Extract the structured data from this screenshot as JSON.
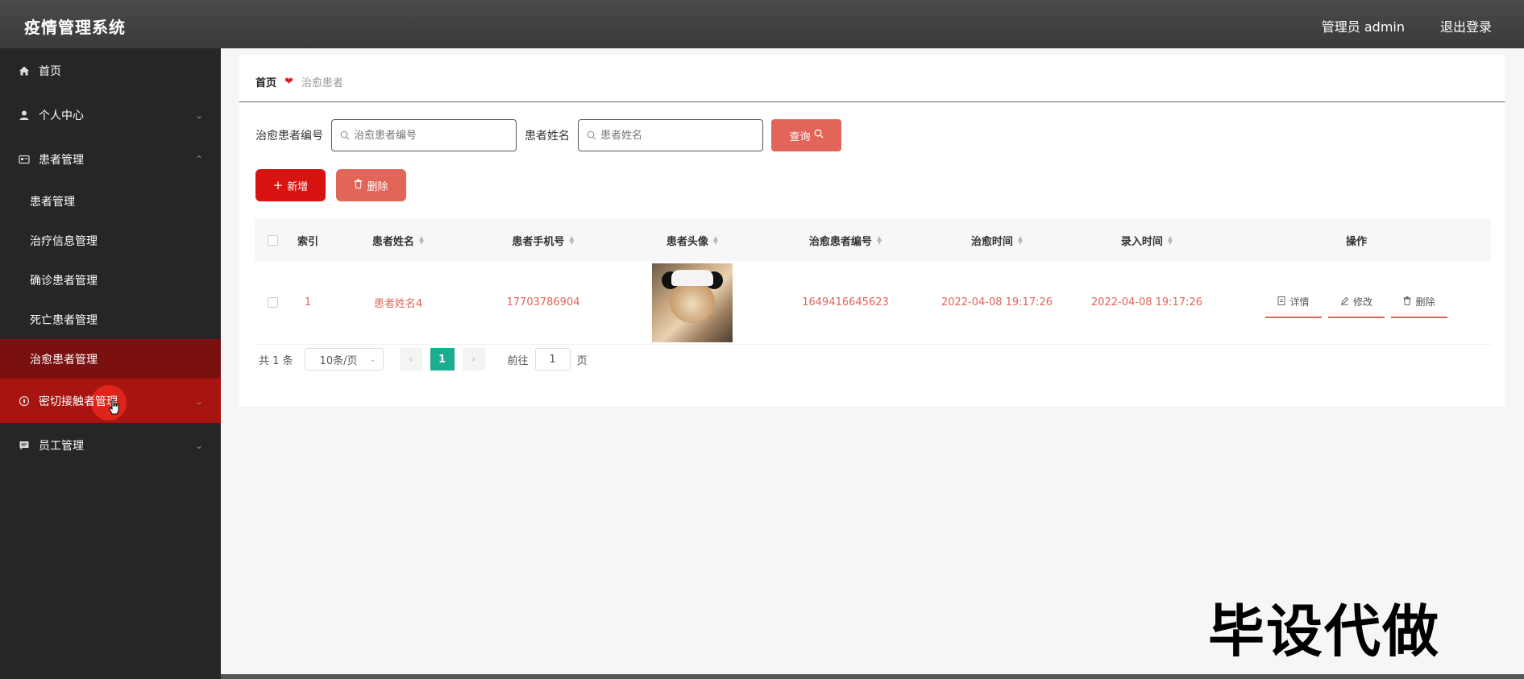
{
  "header": {
    "title": "疫情管理系统",
    "user": "管理员 admin",
    "logout": "退出登录"
  },
  "sidebar": {
    "items": [
      {
        "label": "首页",
        "icon": "home-icon"
      },
      {
        "label": "个人中心",
        "icon": "user-icon"
      },
      {
        "label": "患者管理",
        "icon": "card-icon"
      },
      {
        "label": "密切接触者管理",
        "icon": "compass-icon"
      },
      {
        "label": "员工管理",
        "icon": "chat-icon"
      }
    ],
    "submenu": [
      "患者管理",
      "治疗信息管理",
      "确诊患者管理",
      "死亡患者管理",
      "治愈患者管理"
    ]
  },
  "breadcrumb": {
    "home": "首页",
    "current": "治愈患者"
  },
  "search": {
    "field1_label": "治愈患者编号",
    "field1_placeholder": "治愈患者编号",
    "field2_label": "患者姓名",
    "field2_placeholder": "患者姓名",
    "query_label": "查询"
  },
  "actions": {
    "add_label": "新增",
    "delete_label": "删除"
  },
  "table": {
    "headers": [
      "索引",
      "患者姓名",
      "患者手机号",
      "患者头像",
      "治愈患者编号",
      "治愈时间",
      "录入时间",
      "操作"
    ],
    "rows": [
      {
        "index": "1",
        "name": "患者姓名4",
        "phone": "17703786904",
        "code": "1649416645623",
        "cured_time": "2022-04-08 19:17:26",
        "entry_time": "2022-04-08 19:17:26",
        "ops": [
          "详情",
          "修改",
          "删除"
        ]
      }
    ]
  },
  "pagination": {
    "total": "共 1 条",
    "page_size": "10条/页",
    "current_page": "1",
    "goto_label": "前往",
    "goto_value": "1",
    "page_suffix": "页"
  },
  "watermark": "毕设代做",
  "colors": {
    "accent": "#e26559",
    "primary_red": "#d91212",
    "pager_active": "#1aad8f",
    "sidebar_bg": "#262626"
  }
}
